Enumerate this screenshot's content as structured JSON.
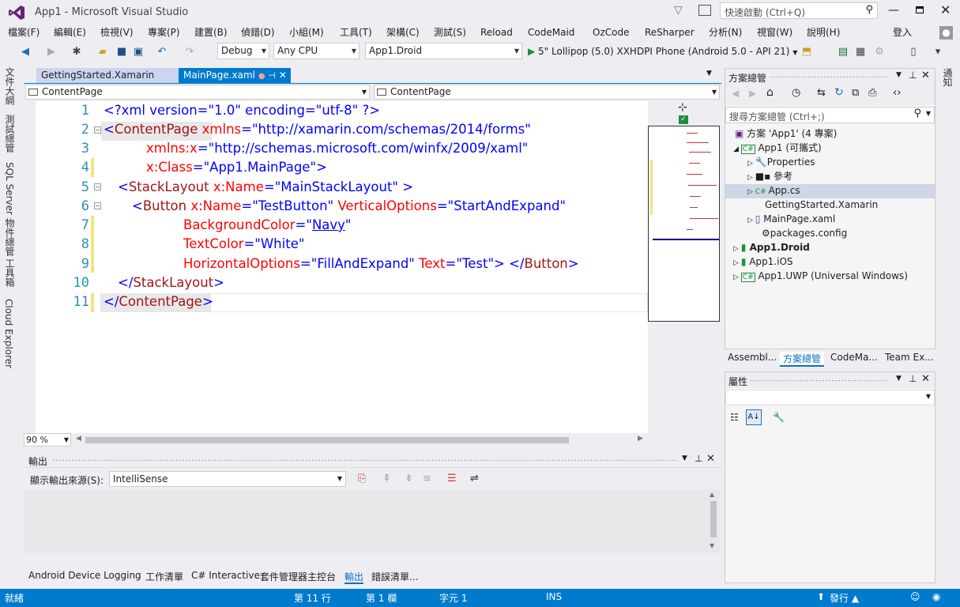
{
  "window": {
    "title": "App1 - Microsoft Visual Studio",
    "quick_launch_placeholder": "快速啟動 (Ctrl+Q)",
    "signin": "登入"
  },
  "menu": [
    "檔案(F)",
    "編輯(E)",
    "檢視(V)",
    "專案(P)",
    "建置(B)",
    "偵錯(D)",
    "小組(M)",
    "工具(T)",
    "架構(C)",
    "測試(S)",
    "Reload",
    "CodeMaid",
    "OzCode",
    "ReSharper",
    "分析(N)",
    "視窗(W)",
    "說明(H)"
  ],
  "toolbar": {
    "config": "Debug",
    "platform": "Any CPU",
    "project": "App1.Droid",
    "run_target": "5\" Lollipop (5.0) XXHDPI Phone (Android 5.0 - API 21)"
  },
  "left_tabs": [
    "文件大綱",
    "測試總管",
    "SQL Server 物件總管",
    "工具箱",
    "Cloud Explorer"
  ],
  "tabs": [
    {
      "label": "GettingStarted.Xamarin"
    },
    {
      "label": "MainPage.xaml"
    }
  ],
  "nav": {
    "left": "ContentPage",
    "right": "ContentPage"
  },
  "editor": {
    "line_numbers": [
      "1",
      "2",
      "3",
      "4",
      "5",
      "6",
      "7",
      "8",
      "9",
      "10",
      "11"
    ],
    "zoom": "90 %"
  },
  "code": {
    "l1": {
      "a": "<?xml version=\"1.0\" encoding=\"utf-8\" ?>"
    },
    "l2": {
      "a": "<",
      "b": "ContentPage",
      "c": " xmlns",
      "d": "=",
      "e": "\"http://xamarin.com/schemas/2014/forms\""
    },
    "l3": {
      "a": "xmlns:x",
      "b": "=",
      "c": "\"http://schemas.microsoft.com/winfx/2009/xaml\""
    },
    "l4": {
      "a": "x:Class",
      "b": "=",
      "c": "\"App1.MainPage\"",
      "d": ">"
    },
    "l5": {
      "a": "<",
      "b": "StackLayout",
      "c": " x:Name",
      "d": "=",
      "e": "\"MainStackLayout\"",
      "f": " >"
    },
    "l6": {
      "a": "<",
      "b": "Button",
      "c": " x:Name",
      "d": "=",
      "e": "\"TestButton\"",
      "f": " VerticalOptions",
      "g": "=",
      "h": "\"StartAndExpand\""
    },
    "l7": {
      "a": "BackgroundColor",
      "b": "=",
      "c": "\"",
      "d": "Navy",
      "e": "\""
    },
    "l8": {
      "a": "TextColor",
      "b": "=",
      "c": "\"White\""
    },
    "l9": {
      "a": "HorizontalOptions",
      "b": "=",
      "c": "\"FillAndExpand\"",
      "d": " Text",
      "e": "=",
      "f": "\"Test\"",
      "g": "> </",
      "h": "Button",
      "i": ">"
    },
    "l10": {
      "a": "</",
      "b": "StackLayout",
      "c": ">"
    },
    "l11": {
      "a": "</",
      "b": "ContentPage",
      "c": ">"
    }
  },
  "output": {
    "title": "輸出",
    "source_label": "顯示輸出來源(S):",
    "source_value": "IntelliSense"
  },
  "bottom_tabs": [
    "Android Device Logging",
    "工作清單",
    "C# Interactive",
    "套件管理器主控台",
    "輸出",
    "錯誤清單..."
  ],
  "solution": {
    "title": "方案總管",
    "search_placeholder": "搜尋方案總管 (Ctrl+;)",
    "items": [
      {
        "label": "方案 'App1' (4 專案)"
      },
      {
        "label": "App1 (可攜式)"
      },
      {
        "label": "Properties"
      },
      {
        "label": "參考"
      },
      {
        "label": "App.cs"
      },
      {
        "label": "GettingStarted.Xamarin"
      },
      {
        "label": "MainPage.xaml"
      },
      {
        "label": "packages.config"
      },
      {
        "label": "App1.Droid"
      },
      {
        "label": "App1.iOS"
      },
      {
        "label": "App1.UWP (Universal Windows)"
      }
    ]
  },
  "sol_tabs": [
    "Assembl...",
    "方案總管",
    "CodeMa...",
    "Team Ex..."
  ],
  "props": {
    "title": "屬性"
  },
  "right_rail": [
    "通知"
  ],
  "status": {
    "ready": "就緒",
    "line": "第 11 行",
    "col": "第 1 欄",
    "char": "字元 1",
    "ins": "INS",
    "publish": "發行 ▲"
  },
  "colors": {
    "accent": "#007acc",
    "vs_purple": "#68217a",
    "active_tab": "#007acc"
  }
}
